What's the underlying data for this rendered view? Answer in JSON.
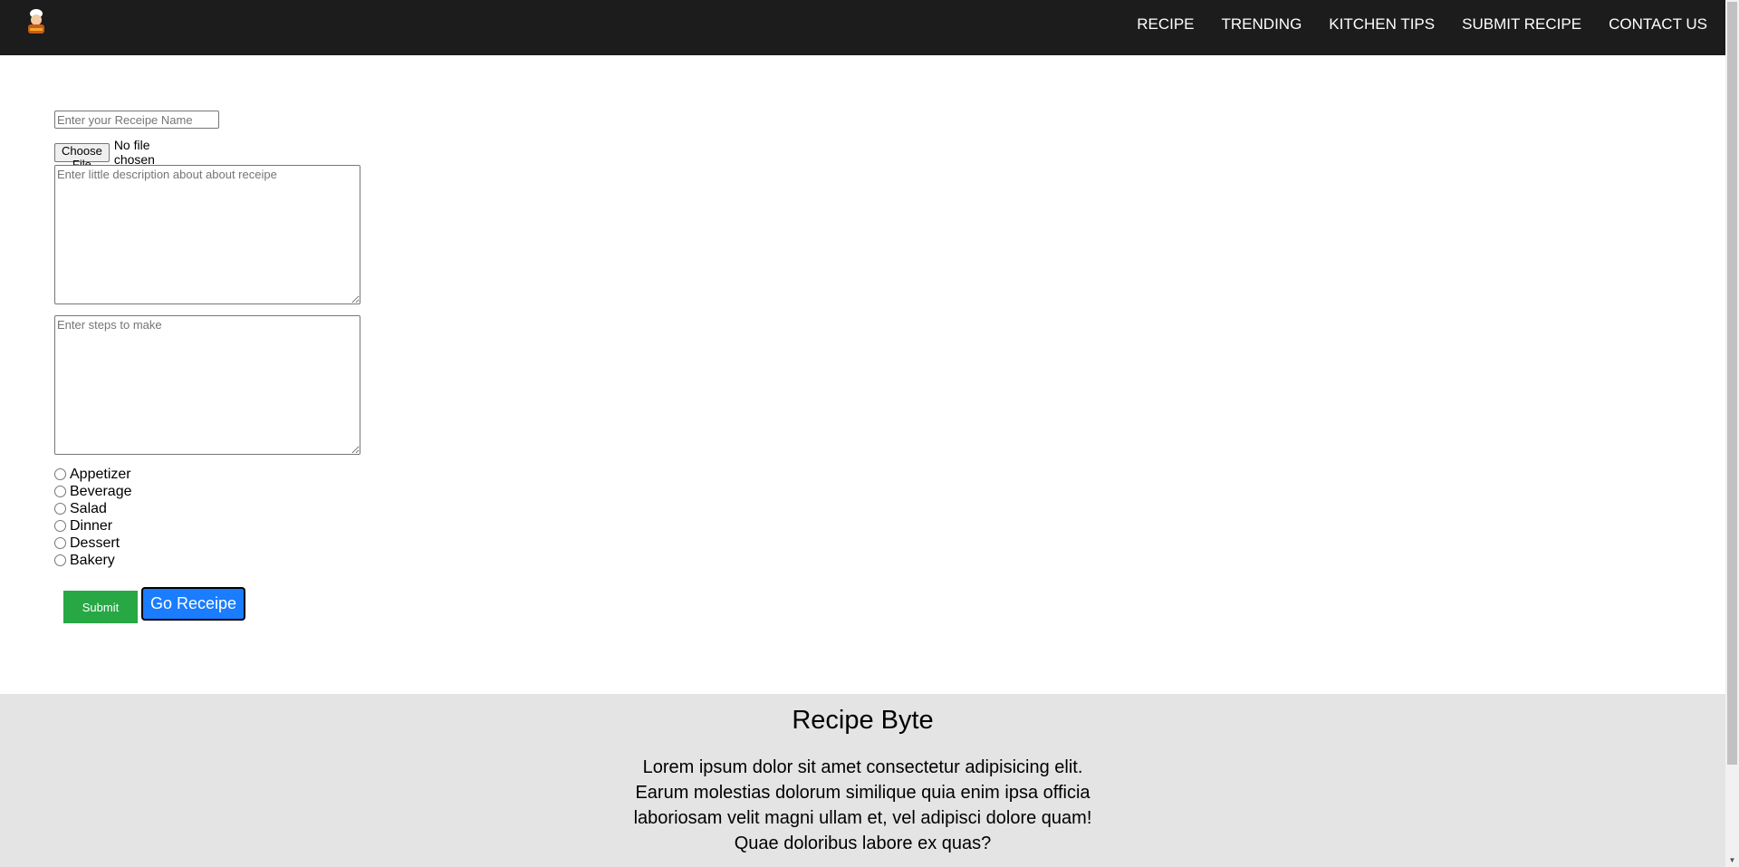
{
  "nav": {
    "logo_name": "chef-logo",
    "links": [
      "RECIPE",
      "TRENDING",
      "KITCHEN TIPS",
      "SUBMIT RECIPE",
      "CONTACT US"
    ]
  },
  "form": {
    "name_placeholder": "Enter your Receipe Name",
    "file_button_label": "Choose File",
    "file_status": "No file chosen",
    "description_placeholder": "Enter little description about about receipe",
    "steps_placeholder": "Enter steps to make",
    "categories": [
      "Appetizer",
      "Beverage",
      "Salad",
      "Dinner",
      "Dessert",
      "Bakery"
    ],
    "submit_label": "Submit",
    "go_label": "Go Receipe"
  },
  "footer": {
    "title": "Recipe Byte",
    "text": "Lorem ipsum dolor sit amet consectetur adipisicing elit. Earum molestias dolorum similique quia enim ipsa officia laboriosam velit magni ullam et, vel adipisci dolore quam! Quae doloribus labore ex quas?"
  },
  "colors": {
    "navbar": "#1c1c1c",
    "submit": "#28a745",
    "go_button": "#1a7cff",
    "footer": "#e4e4e4"
  }
}
